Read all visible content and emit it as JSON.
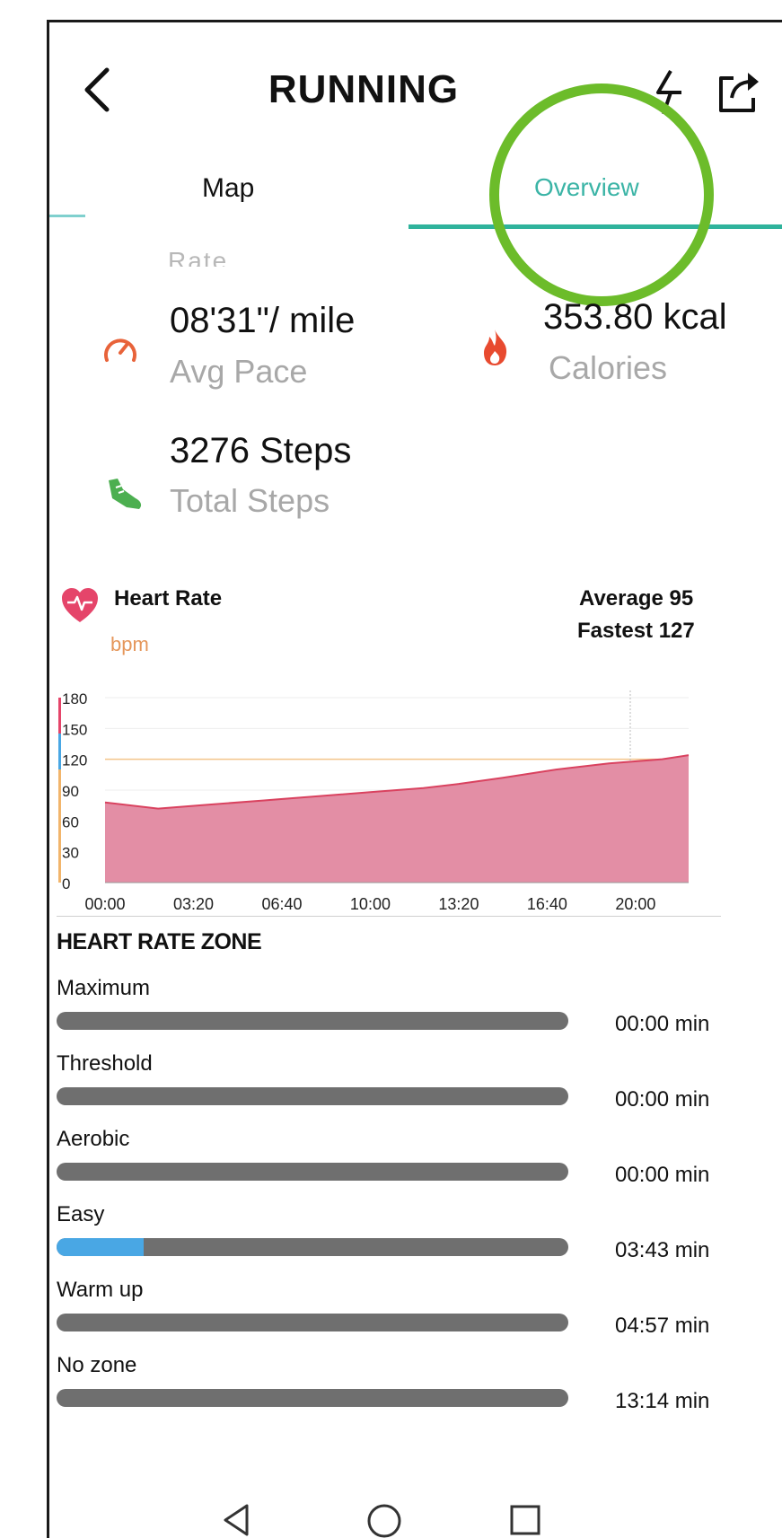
{
  "header": {
    "title": "RUNNING",
    "back_icon": "chevron-left-icon",
    "route_icon": "route-icon",
    "share_icon": "share-icon"
  },
  "tabs": [
    {
      "label": "Map",
      "active": false
    },
    {
      "label": "Overview",
      "active": true
    }
  ],
  "cutoff_label": "Rate",
  "stats": {
    "pace": {
      "value": "08'31\"/ mile",
      "label": "Avg Pace",
      "icon": "speedometer-icon",
      "color": "#e8633a"
    },
    "calories": {
      "value": "353.80",
      "unit": "kcal",
      "label": "Calories",
      "icon": "flame-icon",
      "color": "#e84a2f"
    },
    "steps": {
      "value": "3276 Steps",
      "label": "Total Steps",
      "icon": "shoe-icon",
      "color": "#4caf50"
    }
  },
  "heart_rate": {
    "title": "Heart Rate",
    "unit": "bpm",
    "average": "Average 95",
    "fastest": "Fastest 127",
    "icon": "heart-pulse-icon",
    "color": "#e5456a"
  },
  "chart_data": {
    "type": "area",
    "title": "Heart Rate",
    "ylabel": "bpm",
    "ylim": [
      0,
      180
    ],
    "yticks": [
      "0",
      "30",
      "60",
      "90",
      "120",
      "150",
      "180"
    ],
    "xticks": [
      "00:00",
      "03:20",
      "06:40",
      "10:00",
      "13:20",
      "16:40",
      "20:00"
    ],
    "x": [
      0,
      2,
      4,
      6,
      8,
      10,
      12,
      13.33,
      15,
      17,
      19,
      21,
      22
    ],
    "series": [
      {
        "values": [
          78,
          72,
          76,
          80,
          84,
          88,
          92,
          96,
          102,
          110,
          116,
          120,
          124
        ]
      }
    ],
    "reference_line": 120,
    "fill_color": "#e38ea5",
    "line_color": "#d9425f",
    "grid": true
  },
  "zones": {
    "heading": "HEART RATE ZONE",
    "items": [
      {
        "label": "Maximum",
        "time": "00:00 min",
        "fraction": 0
      },
      {
        "label": "Threshold",
        "time": "00:00 min",
        "fraction": 0
      },
      {
        "label": "Aerobic",
        "time": "00:00 min",
        "fraction": 0
      },
      {
        "label": "Easy",
        "time": "03:43 min",
        "fraction": 0.17
      },
      {
        "label": "Warm up",
        "time": "04:57 min",
        "fraction": 0
      },
      {
        "label": "No zone",
        "time": "13:14 min",
        "fraction": 0
      }
    ]
  },
  "nav": {
    "back_icon": "triangle-back-icon",
    "home_icon": "circle-home-icon",
    "recents_icon": "square-recents-icon"
  }
}
